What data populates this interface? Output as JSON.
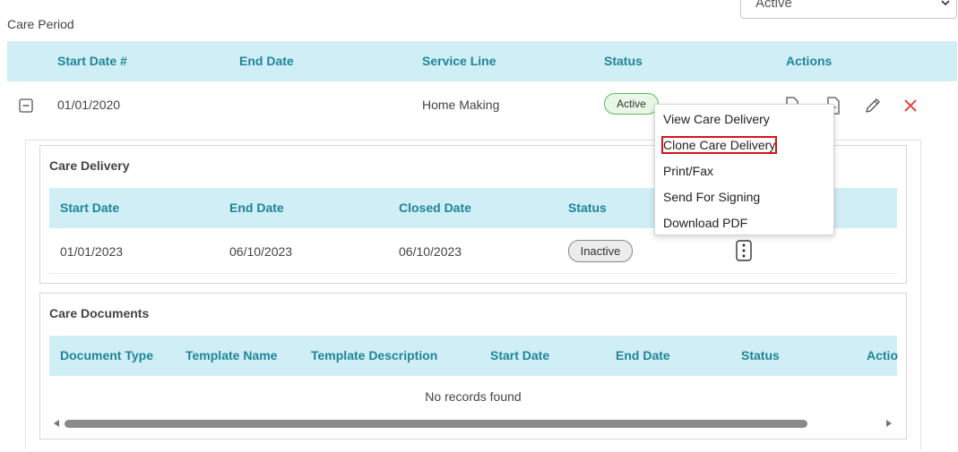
{
  "care_period": {
    "title": "Care Period",
    "status_select": {
      "value": "Active"
    },
    "columns": [
      "Start Date #",
      "End Date",
      "Service Line",
      "Status",
      "Actions"
    ],
    "row": {
      "start_date": "01/01/2020",
      "end_date": "",
      "service_line": "Home Making",
      "status": "Active"
    }
  },
  "actions_menu": {
    "items": [
      "View Care Delivery",
      "Clone Care Delivery",
      "Print/Fax",
      "Send For Signing",
      "Download PDF"
    ],
    "highlighted": "Clone Care Delivery"
  },
  "care_delivery": {
    "title": "Care Delivery",
    "columns": [
      "Start Date",
      "End Date",
      "Closed Date",
      "Status"
    ],
    "row": {
      "start_date": "01/01/2023",
      "end_date": "06/10/2023",
      "closed_date": "06/10/2023",
      "status": "Inactive"
    }
  },
  "care_documents": {
    "title": "Care Documents",
    "columns": [
      "Document Type",
      "Template Name",
      "Template Description",
      "Start Date",
      "End Date",
      "Status",
      "Actio"
    ],
    "empty_message": "No records found"
  },
  "colors": {
    "header_bg": "#d0eef6",
    "header_text": "#1f8596",
    "active_border": "#5cb85c",
    "delete": "#e2453c",
    "highlight_outline": "#d0161c"
  }
}
